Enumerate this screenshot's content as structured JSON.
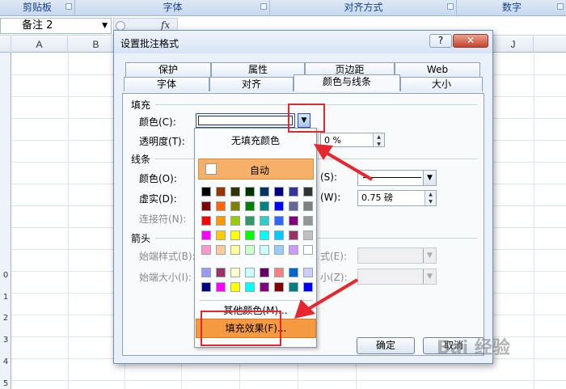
{
  "ribbon": {
    "groups": [
      "剪贴板",
      "字体",
      "对齐方式",
      "数字"
    ]
  },
  "formula_bar": {
    "name_box": "备注 2",
    "fx": "fx"
  },
  "sheet": {
    "columns": [
      "A",
      "B",
      "J"
    ],
    "rows": [
      "0",
      "1",
      "2",
      "3",
      "4",
      "5"
    ]
  },
  "dialog": {
    "title": "设置批注格式",
    "help": "?",
    "close": "✕",
    "tabs_back": [
      "保护",
      "属性",
      "页边距",
      "Web"
    ],
    "tabs_front": [
      "字体",
      "对齐",
      "颜色与线条",
      "大小"
    ],
    "active_tab": "颜色与线条",
    "fill": {
      "section": "填充",
      "color_label": "颜色(C):",
      "transparency_label": "透明度(T):",
      "transparency_value": "0 %"
    },
    "line": {
      "section": "线条",
      "color_label": "颜色(O):",
      "dash_label": "虚实(D):",
      "connector_label": "连接符(N):",
      "style_label_suffix": "(S):",
      "weight_label_suffix": "(W):",
      "weight_value": "0.75 磅"
    },
    "arrows": {
      "section": "箭头",
      "begin_style_label": "始端样式(B):",
      "begin_size_label": "始端大小(I):",
      "end_style_label_suffix": "式(E):",
      "end_size_label_suffix": "小(Z):"
    },
    "ok": "确定",
    "cancel": "取消"
  },
  "color_popup": {
    "no_fill": "无填充颜色",
    "auto": "自动",
    "more_colors": "其他颜色(M)...",
    "fill_effects": "填充效果(F)...",
    "palette": [
      [
        "#000000",
        "#993300",
        "#333300",
        "#003300",
        "#003366",
        "#000080",
        "#333399",
        "#333333"
      ],
      [
        "#800000",
        "#FF6600",
        "#808000",
        "#008000",
        "#008080",
        "#0000FF",
        "#666699",
        "#808080"
      ],
      [
        "#FF0000",
        "#FF9900",
        "#99CC00",
        "#339966",
        "#33CCCC",
        "#3366FF",
        "#800080",
        "#969696"
      ],
      [
        "#FF00FF",
        "#FFCC00",
        "#FFFF00",
        "#00FF00",
        "#00FFFF",
        "#00CCFF",
        "#993366",
        "#C0C0C0"
      ],
      [
        "#FF99CC",
        "#FFCC99",
        "#FFFF99",
        "#CCFFCC",
        "#CCFFFF",
        "#99CCFF",
        "#CC99FF",
        "#FFFFFF"
      ]
    ],
    "palette2": [
      [
        "#9999FF",
        "#993366",
        "#FFFFCC",
        "#CCFFFF",
        "#660066",
        "#FF8080",
        "#0066CC",
        "#CCCCFF"
      ],
      [
        "#000080",
        "#FF00FF",
        "#FFFF00",
        "#00FFFF",
        "#800080",
        "#800000",
        "#008080",
        "#0000FF"
      ]
    ],
    "highlight_color": "#F59A40"
  },
  "watermark": "Bai 经验"
}
